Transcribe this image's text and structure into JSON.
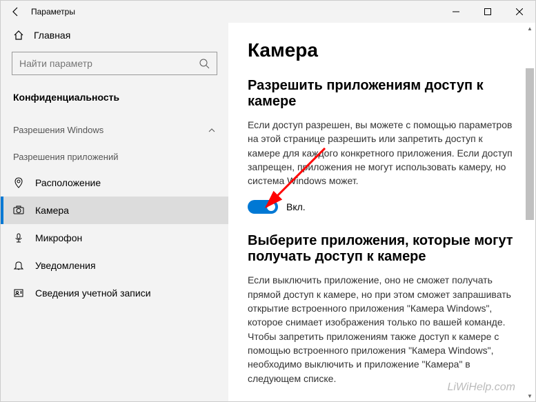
{
  "titlebar": {
    "title": "Параметры"
  },
  "sidebar": {
    "home": "Главная",
    "search_placeholder": "Найти параметр",
    "section": "Конфиденциальность",
    "group1": "Разрешения Windows",
    "group2": "Разрешения приложений",
    "items": [
      {
        "label": "Расположение"
      },
      {
        "label": "Камера"
      },
      {
        "label": "Микрофон"
      },
      {
        "label": "Уведомления"
      },
      {
        "label": "Сведения учетной записи"
      }
    ]
  },
  "content": {
    "heading": "Камера",
    "section1_title": "Разрешить приложениям доступ к камере",
    "section1_desc": "Если доступ разрешен, вы можете с помощью параметров на этой странице разрешить или запретить доступ к камере для каждого конкретного приложения. Если доступ запрещен, приложения не могут использовать камеру, но система Windows может.",
    "toggle_state": "Вкл.",
    "section2_title": "Выберите приложения, которые могут получать доступ к камере",
    "section2_desc": "Если выключить приложение, оно не сможет получать прямой доступ к камере, но при этом сможет запрашивать открытие встроенного приложения \"Камера Windows\", которое снимает изображения только по вашей команде. Чтобы запретить приложениям также доступ к камере с помощью встроенного приложения \"Камера Windows\", необходимо выключить и приложение \"Камера\" в следующем списке."
  },
  "watermark": "LiWiHelp.com"
}
